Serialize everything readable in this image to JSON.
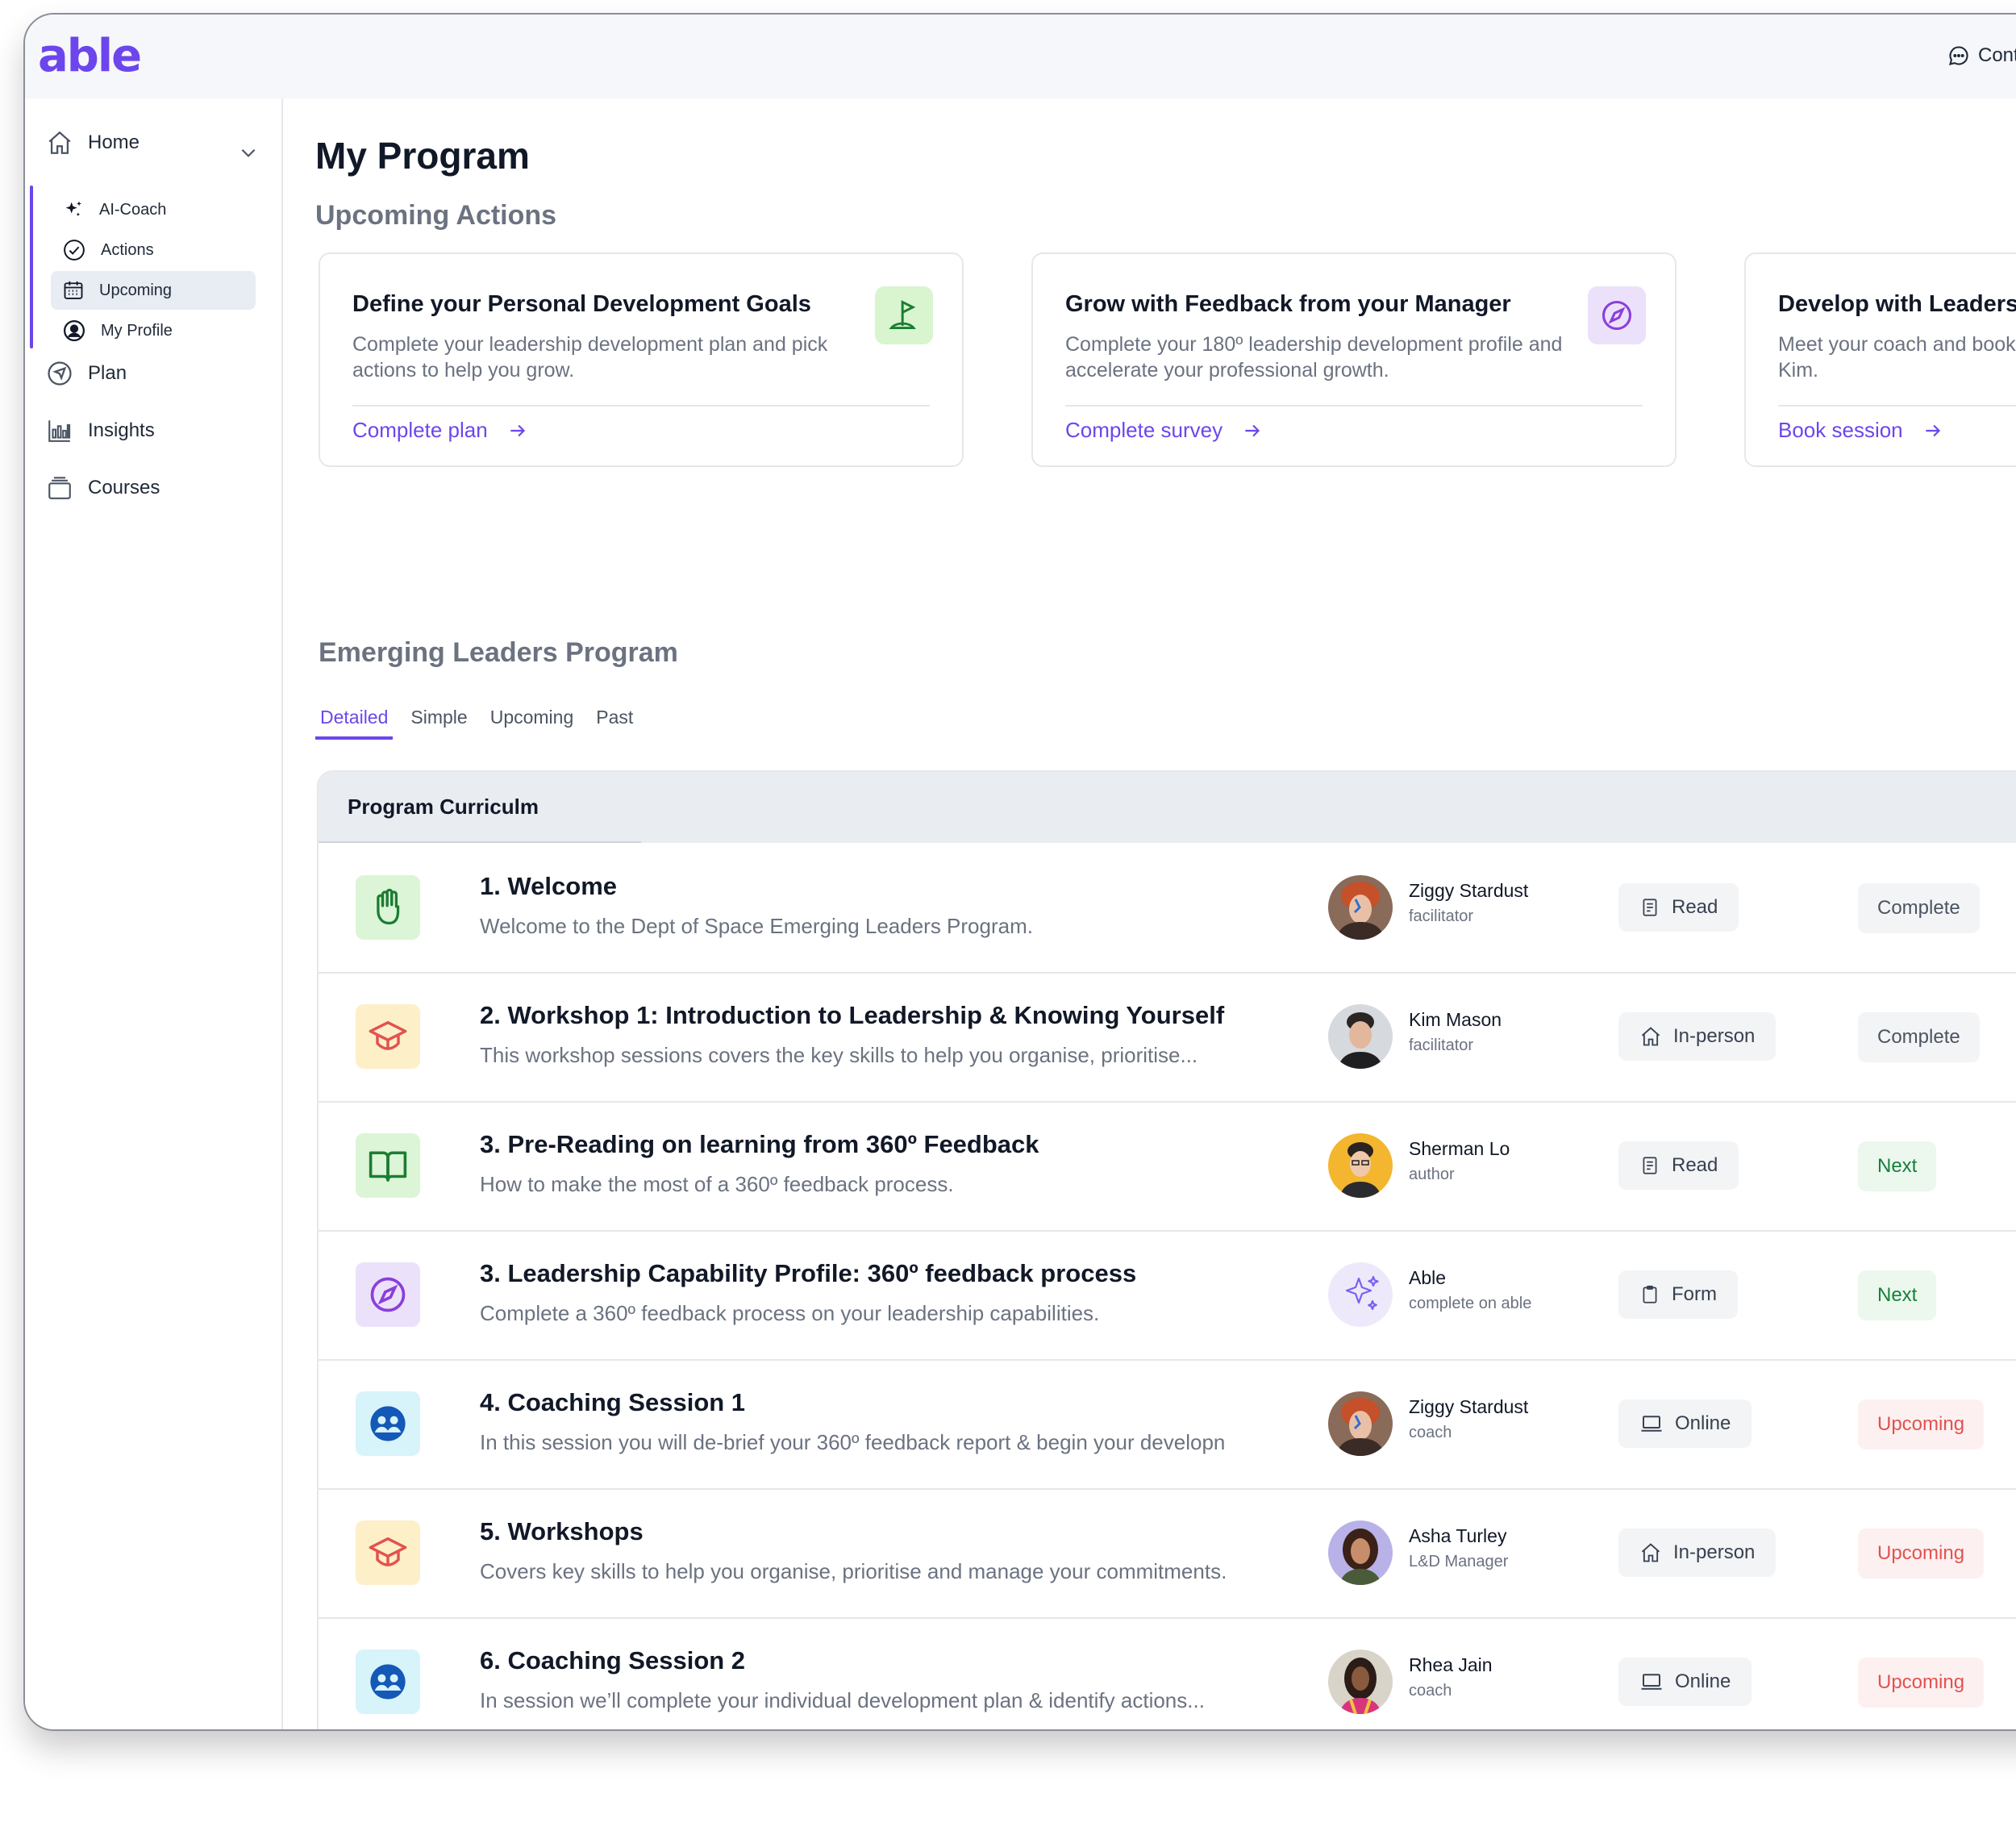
{
  "app": {
    "logo": "able",
    "contact_label": "Cont"
  },
  "sidebar": {
    "home_label": "Home",
    "sub_items": [
      {
        "label": "AI-Coach",
        "icon": "sparkle-icon"
      },
      {
        "label": "Actions",
        "icon": "check-circle-icon"
      },
      {
        "label": "Upcoming",
        "icon": "calendar-icon",
        "active": true
      },
      {
        "label": "My Profile",
        "icon": "user-circle-icon"
      }
    ],
    "items": [
      {
        "label": "Plan",
        "icon": "navigation-icon"
      },
      {
        "label": "Insights",
        "icon": "bar-chart-icon"
      },
      {
        "label": "Courses",
        "icon": "stack-icon"
      }
    ]
  },
  "main": {
    "title": "My Program",
    "upcoming_heading": "Upcoming Actions",
    "cards": [
      {
        "title": "Define your Personal Development Goals",
        "desc": "Complete your leadership development plan and pick actions to help you grow.",
        "link": "Complete plan",
        "icon": "flag-icon",
        "color": "#d8f5cf"
      },
      {
        "title": "Grow with Feedback from your Manager",
        "desc": "Complete your 180º leadership development profile and accelerate your professional growth.",
        "link": "Complete survey",
        "icon": "compass-icon",
        "color": "#ece1fb"
      },
      {
        "title": "Develop with Leadership Coaching",
        "desc": "Meet your coach and book your coaching session with Kim.",
        "link": "Book session",
        "icon": "people-icon",
        "color": "#ddf4fb"
      }
    ],
    "program_heading": "Emerging Leaders Program",
    "tabs": [
      "Detailed",
      "Simple",
      "Upcoming",
      "Past"
    ],
    "curriculum_title": "Program Curriculm",
    "rows": [
      {
        "title": "1. Welcome",
        "desc": "Welcome to the Dept of Space Emerging Leaders Program.",
        "icon": "hand-icon",
        "icon_bg": "#dcf5d6",
        "person": "Ziggy Stardust",
        "role": "facilitator",
        "avatar": "ziggy",
        "type": "Read",
        "type_icon": "document-icon",
        "status": "Complete",
        "status_kind": "complete"
      },
      {
        "title": "2. Workshop 1: Introduction to Leadership & Knowing Yourself",
        "desc": "This workshop sessions covers the key skills to help you organise, prioritise...",
        "icon": "graduation-cap-icon",
        "icon_bg": "#fdefc8",
        "person": "Kim Mason",
        "role": "facilitator",
        "avatar": "kim",
        "type": "In-person",
        "type_icon": "house-icon",
        "status": "Complete",
        "status_kind": "complete"
      },
      {
        "title": "3. Pre-Reading on learning from 360º Feedback",
        "desc": "How to make the most of a 360º feedback process.",
        "icon": "book-icon",
        "icon_bg": "#dcf5d6",
        "person": "Sherman Lo",
        "role": "author",
        "avatar": "sherman",
        "type": "Read",
        "type_icon": "document-icon",
        "status": "Next",
        "status_kind": "next"
      },
      {
        "title": "3. Leadership Capability Profile: 360º feedback process",
        "desc": "Complete a 360º feedback process on your leadership capabilities.",
        "icon": "compass-icon",
        "icon_bg": "#ece1fb",
        "person": "Able",
        "role": "complete on able",
        "avatar": "able",
        "type": "Form",
        "type_icon": "clipboard-icon",
        "status": "Next",
        "status_kind": "next"
      },
      {
        "title": "4. Coaching Session 1",
        "desc": "In this session you will de-brief your 360º feedback report & begin your developn",
        "icon": "people-icon",
        "icon_bg": "#d8f4fb",
        "person": "Ziggy Stardust",
        "role": "coach",
        "avatar": "ziggy",
        "type": "Online",
        "type_icon": "laptop-icon",
        "status": "Upcoming",
        "status_kind": "upcoming"
      },
      {
        "title": "5. Workshops",
        "desc": "Covers key skills to help you organise, prioritise and manage your commitments.",
        "icon": "graduation-cap-icon",
        "icon_bg": "#fdefc8",
        "person": "Asha Turley",
        "role": "L&D Manager",
        "avatar": "asha",
        "type": "In-person",
        "type_icon": "house-icon",
        "status": "Upcoming",
        "status_kind": "upcoming"
      },
      {
        "title": "6. Coaching Session 2",
        "desc": "In session we’ll complete your individual development plan & identify actions...",
        "icon": "people-icon",
        "icon_bg": "#d8f4fb",
        "person": "Rhea Jain",
        "role": "coach",
        "avatar": "rhea",
        "type": "Online",
        "type_icon": "laptop-icon",
        "status": "Upcoming",
        "status_kind": "upcoming"
      }
    ]
  },
  "colors": {
    "accent": "#6c46ec",
    "next": "#15803d",
    "upcoming": "#e2524f"
  }
}
